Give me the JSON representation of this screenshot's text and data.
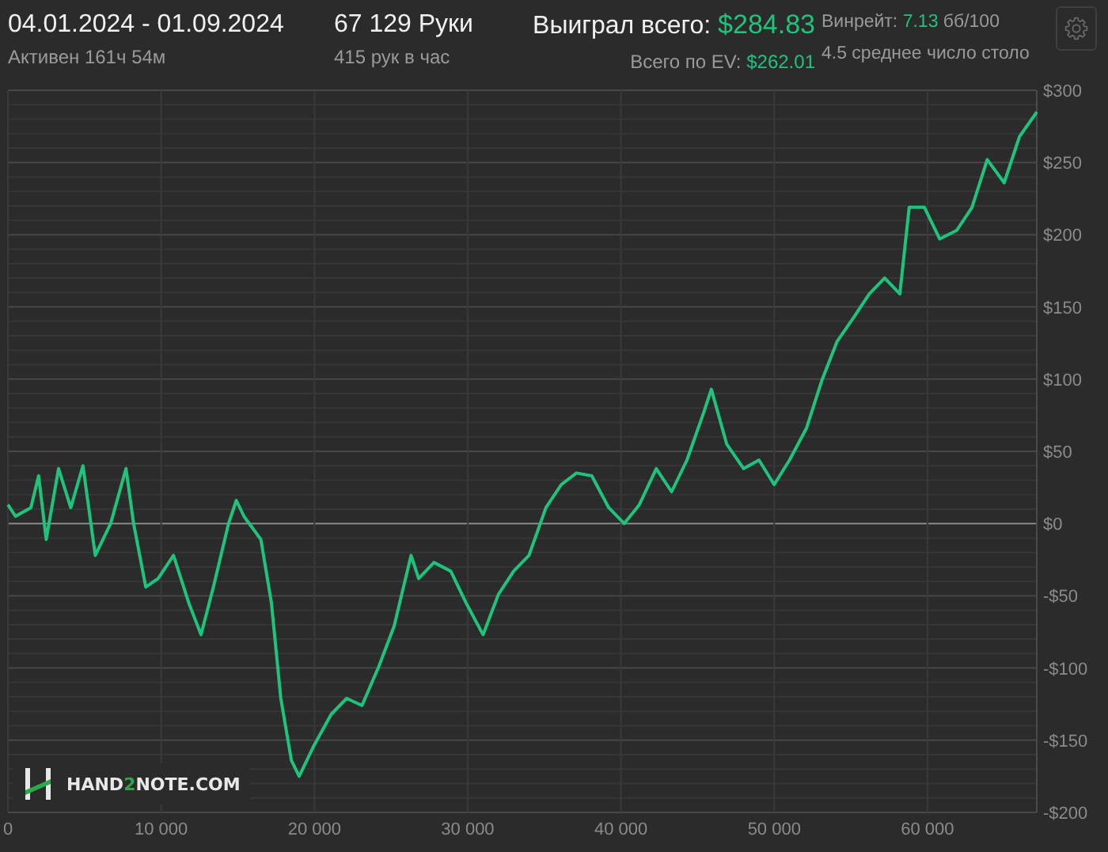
{
  "header": {
    "date_range": "04.01.2024 - 01.09.2024",
    "active_time": "Активен 161ч 54м",
    "hands": "67 129 Руки",
    "hands_per_hour": "415 рук в час",
    "won_total": {
      "label": "Выиграл всего:",
      "value": "$284.83"
    },
    "ev_total": {
      "label": "Всего по EV:",
      "value": "$262.01"
    },
    "winrate": {
      "label": "Винрейт:",
      "value": "7.13",
      "unit": "бб/100"
    },
    "avg_tables": "4.5 среднее число столо"
  },
  "chart": {
    "chart_data": {
      "type": "line",
      "xlim": [
        0,
        67129
      ],
      "ylim": [
        -200,
        300
      ],
      "xticks": [
        {
          "value": 0,
          "label": "0"
        },
        {
          "value": 10000,
          "label": "10 000"
        },
        {
          "value": 20000,
          "label": "20 000"
        },
        {
          "value": 30000,
          "label": "30 000"
        },
        {
          "value": 40000,
          "label": "40 000"
        },
        {
          "value": 50000,
          "label": "50 000"
        },
        {
          "value": 60000,
          "label": "60 000"
        }
      ],
      "yticks": [
        {
          "value": 300,
          "label": "$300"
        },
        {
          "value": 250,
          "label": "$250"
        },
        {
          "value": 200,
          "label": "$200"
        },
        {
          "value": 150,
          "label": "$150"
        },
        {
          "value": 100,
          "label": "$100"
        },
        {
          "value": 50,
          "label": "$50"
        },
        {
          "value": 0,
          "label": "$0"
        },
        {
          "value": -50,
          "label": "-$50"
        },
        {
          "value": -100,
          "label": "-$100"
        },
        {
          "value": -150,
          "label": "-$150"
        },
        {
          "value": -200,
          "label": "-$200"
        }
      ],
      "x": [
        0,
        500,
        1500,
        2000,
        2500,
        3300,
        4100,
        4900,
        5700,
        6700,
        7700,
        8200,
        9000,
        9800,
        10800,
        11800,
        12600,
        13400,
        14400,
        14900,
        15400,
        16500,
        17200,
        17800,
        18500,
        19000,
        20000,
        21100,
        22100,
        23100,
        24200,
        25200,
        26300,
        26800,
        27800,
        28900,
        29900,
        31000,
        32000,
        33000,
        34000,
        35100,
        36100,
        37100,
        38100,
        39200,
        40200,
        41200,
        42300,
        43300,
        44300,
        45400,
        45900,
        46900,
        48000,
        49000,
        50000,
        51000,
        52100,
        53100,
        54100,
        55200,
        56200,
        57200,
        58200,
        58800,
        59800,
        60800,
        61900,
        62900,
        63900,
        65000,
        66000,
        67000,
        67129
      ],
      "grid": true,
      "series": [
        {
          "color": "#1fc47c",
          "values": [
            13,
            5,
            11,
            33,
            -11,
            38,
            11,
            40,
            -22,
            0,
            38,
            0,
            -44,
            -38,
            -22,
            -55,
            -77,
            -44,
            0,
            16,
            5,
            -11,
            -55,
            -121,
            -164,
            -175,
            -153,
            -132,
            -121,
            -126,
            -99,
            -71,
            -22,
            -38,
            -27,
            -33,
            -55,
            -77,
            -49,
            -33,
            -22,
            11,
            27,
            35,
            33,
            11,
            0,
            13,
            38,
            22,
            44,
            77,
            93,
            55,
            38,
            44,
            27,
            44,
            66,
            99,
            126,
            143,
            159,
            170,
            159,
            219,
            219,
            197,
            203,
            219,
            252,
            236,
            268,
            283,
            285
          ]
        }
      ]
    }
  },
  "logo": {
    "before": "HAND",
    "highlight": "2",
    "after": "NOTE.COM"
  }
}
